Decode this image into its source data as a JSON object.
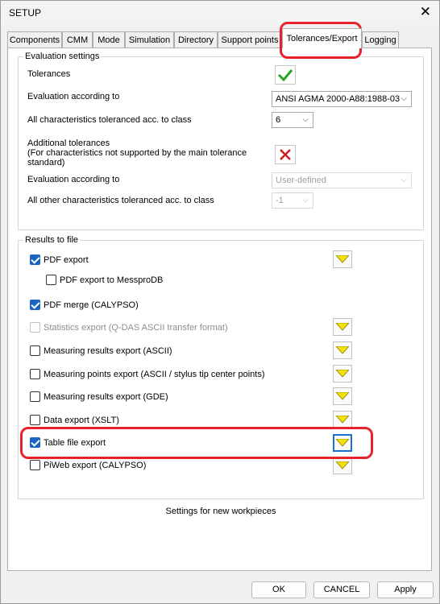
{
  "window": {
    "title": "SETUP",
    "close_label": "✕"
  },
  "tabs": [
    {
      "label": "Components"
    },
    {
      "label": "CMM"
    },
    {
      "label": "Mode"
    },
    {
      "label": "Simulation"
    },
    {
      "label": "Directory"
    },
    {
      "label": "Support points"
    },
    {
      "label": "Tolerances/Export",
      "active": true
    },
    {
      "label": "Logging"
    }
  ],
  "evaluation": {
    "legend": "Evaluation settings",
    "tolerances_label": "Tolerances",
    "tolerances_enabled": true,
    "according_label": "Evaluation according to",
    "according_value": "ANSI AGMA 2000-A88:1988-03",
    "class_label": "All characteristics toleranced acc. to class",
    "class_value": "6",
    "additional_label_1": "Additional tolerances",
    "additional_label_2": "(For characteristics not supported by the main tolerance",
    "additional_label_3": "standard)",
    "additional_enabled": false,
    "according2_label": "Evaluation according to",
    "according2_value": "User-defined",
    "other_class_label": "All other characteristics toleranced acc. to class",
    "other_class_value": "-1"
  },
  "results": {
    "legend": "Results to file",
    "items": [
      {
        "label": "PDF export",
        "checked": true,
        "disabled": false,
        "has_dropdown": true
      },
      {
        "label": "PDF export to MessproDB",
        "checked": false,
        "disabled": false,
        "has_dropdown": false
      },
      {
        "label": "PDF merge (CALYPSO)",
        "checked": true,
        "disabled": false,
        "has_dropdown": false
      },
      {
        "label": "Statistics export (Q-DAS ASCII transfer format)",
        "checked": false,
        "disabled": true,
        "has_dropdown": true
      },
      {
        "label": "Measuring results export (ASCII)",
        "checked": false,
        "disabled": false,
        "has_dropdown": true
      },
      {
        "label": "Measuring points export (ASCII / stylus tip center points)",
        "checked": false,
        "disabled": false,
        "has_dropdown": true
      },
      {
        "label": "Measuring results export (GDE)",
        "checked": false,
        "disabled": false,
        "has_dropdown": true
      },
      {
        "label": "Data export (XSLT)",
        "checked": false,
        "disabled": false,
        "has_dropdown": true
      },
      {
        "label": "Table file export",
        "checked": true,
        "disabled": false,
        "has_dropdown": true
      },
      {
        "label": "PiWeb export (CALYPSO)",
        "checked": false,
        "disabled": false,
        "has_dropdown": true
      }
    ]
  },
  "footer": {
    "settings_label": "Settings for new workpieces"
  },
  "buttons": {
    "ok": "OK",
    "cancel": "CANCEL",
    "apply": "Apply"
  },
  "colors": {
    "accent": "#1a65c4",
    "highlight": "#e8222b",
    "check_green": "#2aa52a",
    "cross_red": "#d0201f",
    "dropdown_yellow": "#f5e10a"
  }
}
